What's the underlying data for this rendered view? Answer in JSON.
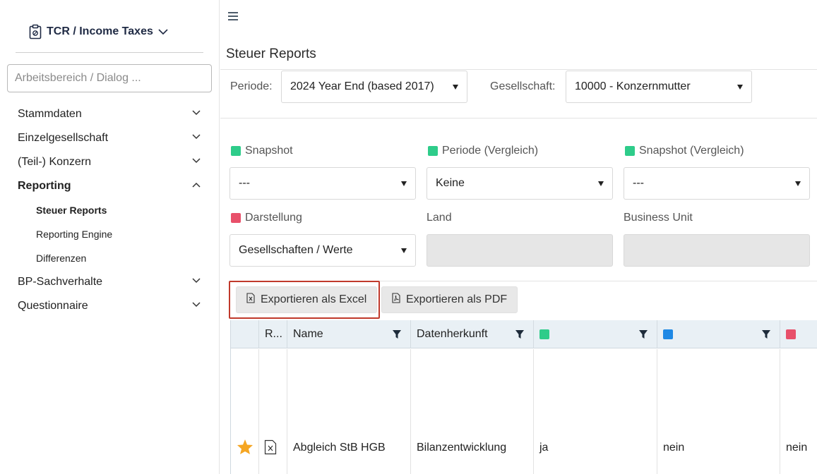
{
  "app": {
    "title": "TCR / Income Taxes"
  },
  "search": {
    "placeholder": "Arbeitsbereich / Dialog ..."
  },
  "sidebar": {
    "items": [
      {
        "label": "Stammdaten"
      },
      {
        "label": "Einzelgesellschaft"
      },
      {
        "label": "(Teil-) Konzern"
      },
      {
        "label": "Reporting"
      },
      {
        "label": "BP-Sachverhalte"
      },
      {
        "label": "Questionnaire"
      }
    ],
    "reporting_sub": [
      {
        "label": "Steuer Reports"
      },
      {
        "label": "Reporting Engine"
      },
      {
        "label": "Differenzen"
      }
    ]
  },
  "page": {
    "title": "Steuer Reports"
  },
  "filters": {
    "periode_label": "Periode:",
    "periode_value": "2024 Year End (based 2017)",
    "gesellschaft_label": "Gesellschaft:",
    "gesellschaft_value": "10000 - Konzernmutter"
  },
  "fields": {
    "snapshot": {
      "label": "Snapshot",
      "value": "---",
      "color": "#2ecc8a"
    },
    "periode_vergleich": {
      "label": "Periode (Vergleich)",
      "value": "Keine",
      "color": "#2ecc8a"
    },
    "snapshot_vergleich": {
      "label": "Snapshot (Vergleich)",
      "value": "---",
      "color": "#2ecc8a"
    },
    "darstellung": {
      "label": "Darstellung",
      "value": "Gesellschaften / Werte",
      "color": "#e8506a"
    },
    "land": {
      "label": "Land",
      "value": ""
    },
    "business_unit": {
      "label": "Business Unit",
      "value": ""
    }
  },
  "toolbar": {
    "export_excel": "Exportieren als Excel",
    "export_pdf": "Exportieren als PDF"
  },
  "table": {
    "headers": {
      "r": "R...",
      "name": "Name",
      "datenherkunft": "Datenherkunft"
    },
    "header_colors": [
      "#2ecc8a",
      "#1e88e5",
      "#e8506a"
    ],
    "rows": [
      {
        "name": "Abgleich StB HGB",
        "datenherkunft": "Bilanzentwicklung",
        "c1": "ja",
        "c2": "nein",
        "c3": "nein"
      }
    ]
  },
  "colors": {
    "accent_green": "#2ecc8a",
    "accent_blue": "#1e88e5",
    "accent_red": "#e8506a",
    "star": "#f5a623"
  }
}
